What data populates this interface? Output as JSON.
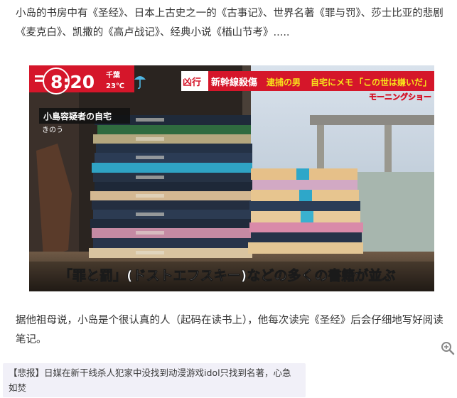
{
  "article": {
    "paragraph_1": "小岛的书房中有《圣经》、日本上古史之一的《古事记》、世界名著《罪与罚》、莎士比亚的悲剧《麦克白》、凯撒的《高卢战记》、经典小说《楢山节考》.....",
    "paragraph_2": "据他祖母说，小岛是个很认真的人（起码在读书上），他每次读完《圣经》后会仔细地写好阅读笔记。"
  },
  "tv_screen": {
    "clock": "8:20",
    "region": "千葉",
    "temperature": "23℃",
    "headline_tag": "凶行",
    "headline_text": "新幹線殺傷",
    "headline_sub": "逮捕の男",
    "headline_note": "自宅にメモ",
    "headline_quote": "「この世は嫌いだ」",
    "program_logo": "モーニングショー",
    "location_caption": "小島容疑者の自宅",
    "date_caption": "きのう",
    "subtitle": "「罪と罰」(ドストエフスキー)などの多くの書籍が並ぶ"
  },
  "footer": {
    "tag": "【悲报】",
    "link_text": "日媒在新干线杀人犯家中没找到动漫游戏idol只找到名著，心急如焚"
  },
  "colors": {
    "red_banner": "#d5162a",
    "yellow_text": "#f7e21b",
    "sky": "#c7d4e2"
  },
  "icons": {
    "weather": "umbrella-icon",
    "zoom": "zoom-in-icon"
  }
}
